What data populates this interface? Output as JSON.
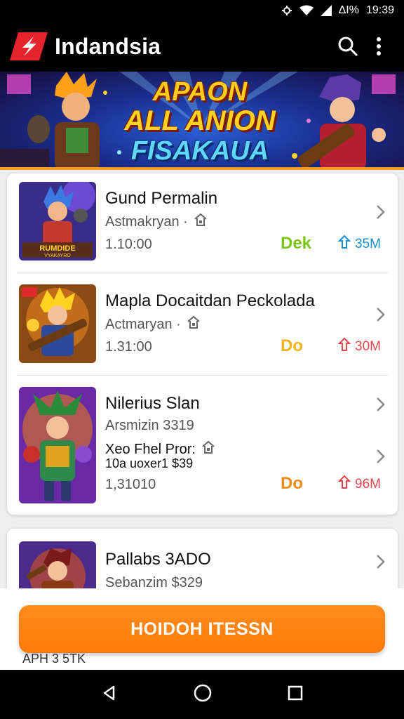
{
  "status_bar": {
    "battery_text": "ΔΙ%",
    "time": "19:39"
  },
  "app_bar": {
    "title": "Indandsia",
    "brand_color": "#e5242b"
  },
  "banner": {
    "line1": "APAON",
    "line2": "ALL ANION",
    "line3": "FISAKAUA"
  },
  "items": [
    {
      "title": "Gund Permalin",
      "subtitle": "Astmakryan ·",
      "number": "1.10:00",
      "tag": "Dek",
      "tag_color": "#7cc516",
      "size": "35M",
      "size_color": "#1a8fd0"
    },
    {
      "title": "Mapla Docaitdan Peckolada",
      "subtitle": "Actmaryan ·",
      "number": "1.31:00",
      "tag": "Do",
      "tag_color": "#f3b21c",
      "size": "30M",
      "size_color": "#e4484f"
    },
    {
      "title": "Nilerius Slan",
      "subtitle": "Arsmizin 3319",
      "extra_line1": "Xeo Fhel Pror:",
      "extra_line2": "10a uoxer1 $39",
      "number": "1,31010",
      "tag": "Do",
      "tag_color": "#f08a12",
      "size": "96M",
      "size_color": "#e4484f"
    },
    {
      "title": "Pallabs 3ADO",
      "subtitle": "Sebanzim $329"
    }
  ],
  "cta": {
    "label": "HOIDOH ITESSN"
  },
  "footer_text": "APH 3 5TK"
}
